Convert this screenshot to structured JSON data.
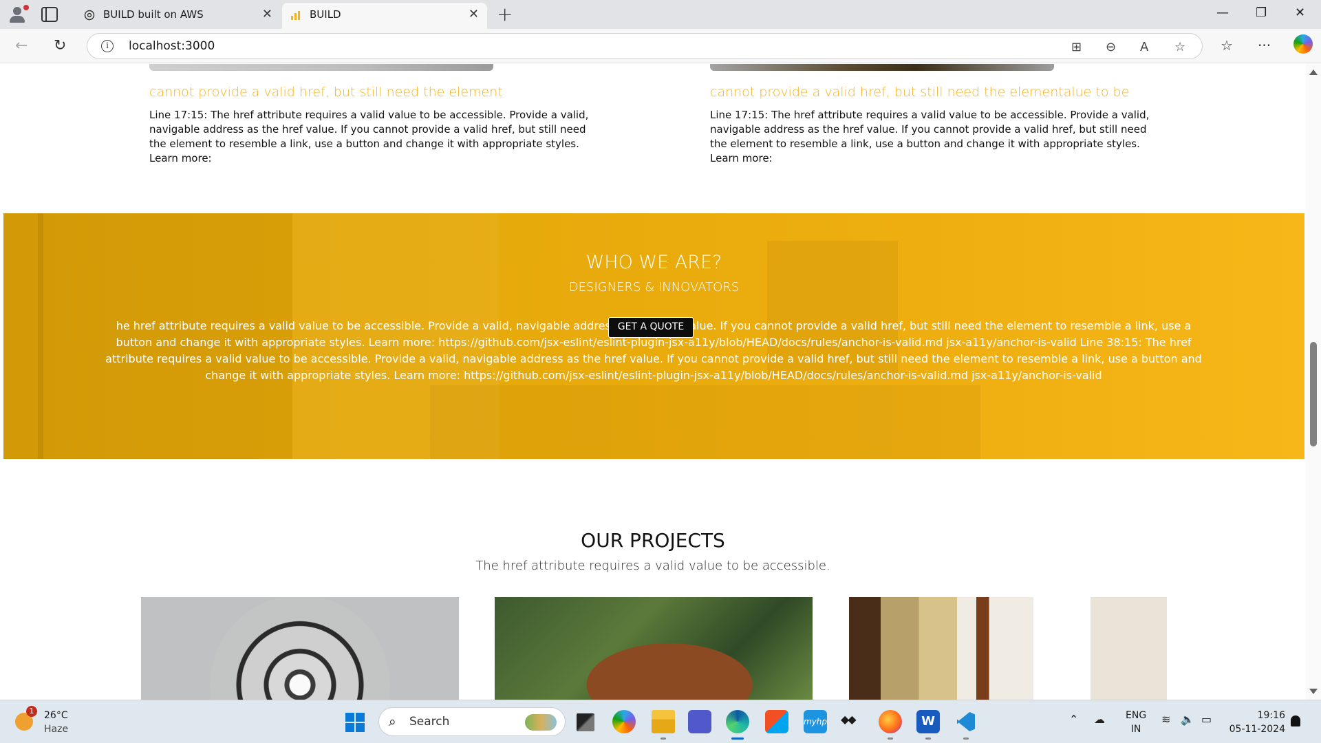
{
  "browser": {
    "tabs": [
      {
        "title": "BUILD built on AWS",
        "active": false
      },
      {
        "title": "BUILD",
        "active": true
      }
    ],
    "url": "localhost:3000"
  },
  "page": {
    "top_cards": [
      {
        "title": "cannot provide a valid href, but still need the element",
        "text": "Line 17:15: The href attribute requires a valid value to be accessible. Provide a valid, navigable address as the href value. If you cannot provide a valid href, but still need the element to resemble a link, use a button and change it with appropriate styles. Learn more:"
      },
      {
        "title": "cannot provide a valid href, but still need the elementalue to be",
        "text": "Line 17:15: The href attribute requires a valid value to be accessible. Provide a valid, navigable address as the href value. If you cannot provide a valid href, but still need the element to resemble a link, use a button and change it with appropriate styles. Learn more:"
      }
    ],
    "who": {
      "title": "WHO WE ARE?",
      "subtitle": "DESIGNERS & INNOVATORS",
      "text": "he href attribute requires a valid value to be accessible. Provide a valid, navigable address as the href value. If you cannot provide a valid href, but still need the element to resemble a link, use a button and change it with appropriate styles. Learn more: https://github.com/jsx-eslint/eslint-plugin-jsx-a11y/blob/HEAD/docs/rules/anchor-is-valid.md jsx-a11y/anchor-is-valid Line 38:15: The href attribute requires a valid value to be accessible. Provide a valid, navigable address as the href value. If you cannot provide a valid href, but still need the element to resemble a link, use a button and change it with appropriate styles. Learn more: https://github.com/jsx-eslint/eslint-plugin-jsx-a11y/blob/HEAD/docs/rules/anchor-is-valid.md jsx-a11y/anchor-is-valid",
      "button": "GET A QUOTE"
    },
    "projects": {
      "title": "OUR PROJECTS",
      "subtitle": "The href attribute requires a valid value to be accessible."
    }
  },
  "taskbar": {
    "weather": {
      "temp": "26°C",
      "condition": "Haze",
      "badge": "1"
    },
    "search_label": "Search",
    "lang_primary": "ENG",
    "lang_secondary": "IN",
    "time": "19:16",
    "date": "05-11-2024"
  },
  "colors": {
    "accent_yellow": "#f5b21a",
    "band_yellow": "#e8aa0c",
    "button_dark": "#0d0d0d"
  }
}
